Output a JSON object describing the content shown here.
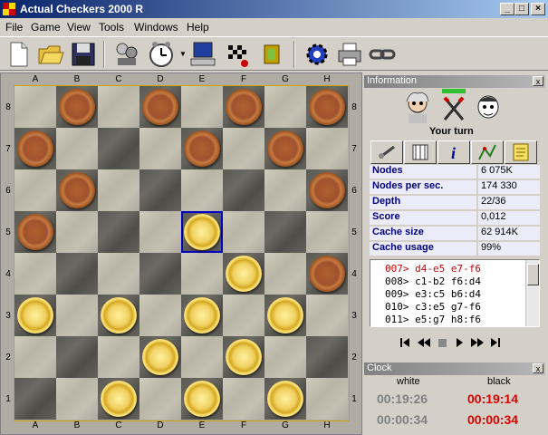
{
  "window": {
    "title": "Actual Checkers 2000 R"
  },
  "menu": [
    "File",
    "Game",
    "View",
    "Tools",
    "Windows",
    "Help"
  ],
  "toolbar": {
    "icons": [
      "new-game-icon",
      "open-folder-icon",
      "save-icon",
      "players-icon",
      "clock-icon",
      "computer-icon",
      "checkered-flag-icon",
      "pieces-icon",
      "settings-gear-icon",
      "printer-icon",
      "link-icon"
    ]
  },
  "board": {
    "files": [
      "A",
      "B",
      "C",
      "D",
      "E",
      "F",
      "G",
      "H"
    ],
    "ranks": [
      "8",
      "7",
      "6",
      "5",
      "4",
      "3",
      "2",
      "1"
    ],
    "pieces": [
      {
        "sq": "b8",
        "c": "b"
      },
      {
        "sq": "d8",
        "c": "b"
      },
      {
        "sq": "f8",
        "c": "b"
      },
      {
        "sq": "h8",
        "c": "b"
      },
      {
        "sq": "a7",
        "c": "b"
      },
      {
        "sq": "e7",
        "c": "b"
      },
      {
        "sq": "g7",
        "c": "b"
      },
      {
        "sq": "b6",
        "c": "b"
      },
      {
        "sq": "h6",
        "c": "b"
      },
      {
        "sq": "a5",
        "c": "b"
      },
      {
        "sq": "e5",
        "c": "w"
      },
      {
        "sq": "f4",
        "c": "w"
      },
      {
        "sq": "h4",
        "c": "b"
      },
      {
        "sq": "a3",
        "c": "w"
      },
      {
        "sq": "c3",
        "c": "w"
      },
      {
        "sq": "e3",
        "c": "w"
      },
      {
        "sq": "g3",
        "c": "w"
      },
      {
        "sq": "d2",
        "c": "w"
      },
      {
        "sq": "f2",
        "c": "w"
      },
      {
        "sq": "c1",
        "c": "w"
      },
      {
        "sq": "e1",
        "c": "w"
      },
      {
        "sq": "g1",
        "c": "w"
      }
    ],
    "selected": "e5"
  },
  "info": {
    "title": "Information",
    "close": "x",
    "turn": "Your turn",
    "stats": [
      {
        "k": "Nodes",
        "v": "6 075K"
      },
      {
        "k": "Nodes per sec.",
        "v": "174 330"
      },
      {
        "k": "Depth",
        "v": "22/36"
      },
      {
        "k": "Score",
        "v": "0,012"
      },
      {
        "k": "Cache size",
        "v": "62 914K"
      },
      {
        "k": "Cache usage",
        "v": "99%"
      }
    ],
    "moves": [
      {
        "t": "007> d4-e5  e7-f6",
        "active": true
      },
      {
        "t": "008> c1-b2  f6:d4",
        "active": false
      },
      {
        "t": "009> e3:c5  b6:d4",
        "active": false
      },
      {
        "t": "010> c3:e5  g7-f6",
        "active": false
      },
      {
        "t": "011> e5:g7  h8:f6",
        "active": false
      }
    ],
    "tabs": [
      "analysis-tab-icon",
      "book-tab-icon",
      "info-tab-icon",
      "graph-tab-icon",
      "notes-tab-icon"
    ]
  },
  "clock": {
    "title": "Clock",
    "close": "x",
    "white_label": "white",
    "black_label": "black",
    "white_total": "00:19:26",
    "black_total": "00:19:14",
    "white_move": "00:00:34",
    "black_move": "00:00:34"
  },
  "colors": {
    "accent": "#0a246a",
    "active_move": "#cc0000",
    "black_clock": "#e00000",
    "white_clock": "#808080"
  }
}
